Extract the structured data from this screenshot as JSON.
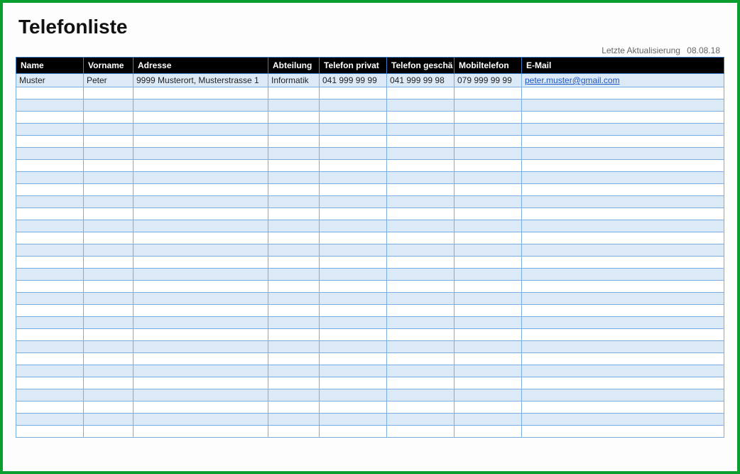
{
  "title": "Telefonliste",
  "last_update_label": "Letzte Aktualisierung",
  "last_update_date": "08.08.18",
  "columns": [
    "Name",
    "Vorname",
    "Adresse",
    "Abteilung",
    "Telefon privat",
    "Telefon geschä",
    "Mobiltelefon",
    "E-Mail"
  ],
  "empty_row_count": 29,
  "rows": [
    {
      "name": "Muster",
      "vorname": "Peter",
      "adresse": "9999 Musterort, Musterstrasse 1",
      "abteilung": "Informatik",
      "telefon_privat": "041 999 99 99",
      "telefon_geschaeft": "041 999 99 98",
      "mobiltelefon": "079 999 99 99",
      "email": "peter.muster@gmail.com"
    }
  ]
}
